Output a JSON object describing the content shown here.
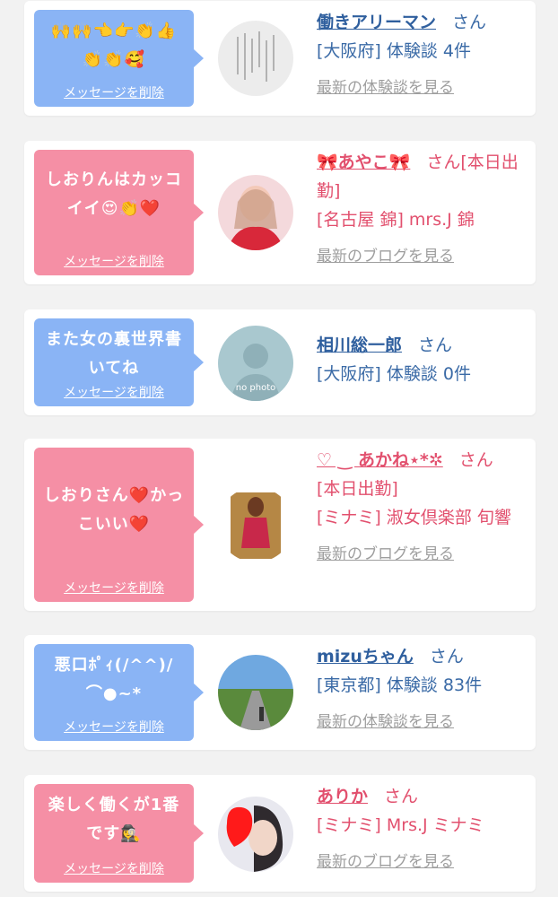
{
  "delete_label": "メッセージを削除",
  "colors": {
    "blue_bubble": "#8ab4f5",
    "pink_bubble": "#f58fa5",
    "blue_text": "#2f5f9e",
    "pink_text": "#e2506e"
  },
  "items": [
    {
      "theme": "blue",
      "message": "🙌🙌👈👉👏👍👏👏🥰",
      "avatar": "handwritten-letter-photo",
      "name": "働きアリーマン",
      "san": "さん",
      "detail": "[大阪府] 体験談 4件",
      "link": "最新の体験談を見る"
    },
    {
      "theme": "pink",
      "message": "しおりんはカッコイイ😍👏❤️",
      "avatar": "woman-portrait-red",
      "name": "🎀あやこ🎀",
      "san": "さん[本日出勤]",
      "detail": "[名古屋 錦] mrs.J 錦",
      "link": "最新のブログを見る"
    },
    {
      "theme": "blue",
      "message": "また女の裏世界書いてね",
      "avatar": "no-photo",
      "avatar_text": "no photo",
      "name": "相川総一郎",
      "san": "さん",
      "detail": "[大阪府] 体験談 0件",
      "link": ""
    },
    {
      "theme": "pink",
      "message": "しおりさん❤️かっこいい❤️",
      "avatar": "woman-on-chair",
      "name": "♡ ‿ あかね⋆*✲",
      "san": "さん",
      "badge": "[本日出勤]",
      "detail": "[ミナミ] 淑女倶楽部 旬響",
      "link": "最新のブログを見る"
    },
    {
      "theme": "blue",
      "message": "悪口ﾎﾟｨ(/^^)/ ⌒●~*",
      "avatar": "road-landscape",
      "name": "mizuちゃん",
      "san": "さん",
      "detail": "[東京都] 体験談 83件",
      "link": "最新の体験談を見る"
    },
    {
      "theme": "pink",
      "message": "楽しく働くが1番です🕵️‍♀",
      "avatar": "woman-heart-covered",
      "name": "ありか",
      "san": "さん",
      "detail": "[ミナミ] Mrs.J ミナミ",
      "link": "最新のブログを見る"
    }
  ]
}
